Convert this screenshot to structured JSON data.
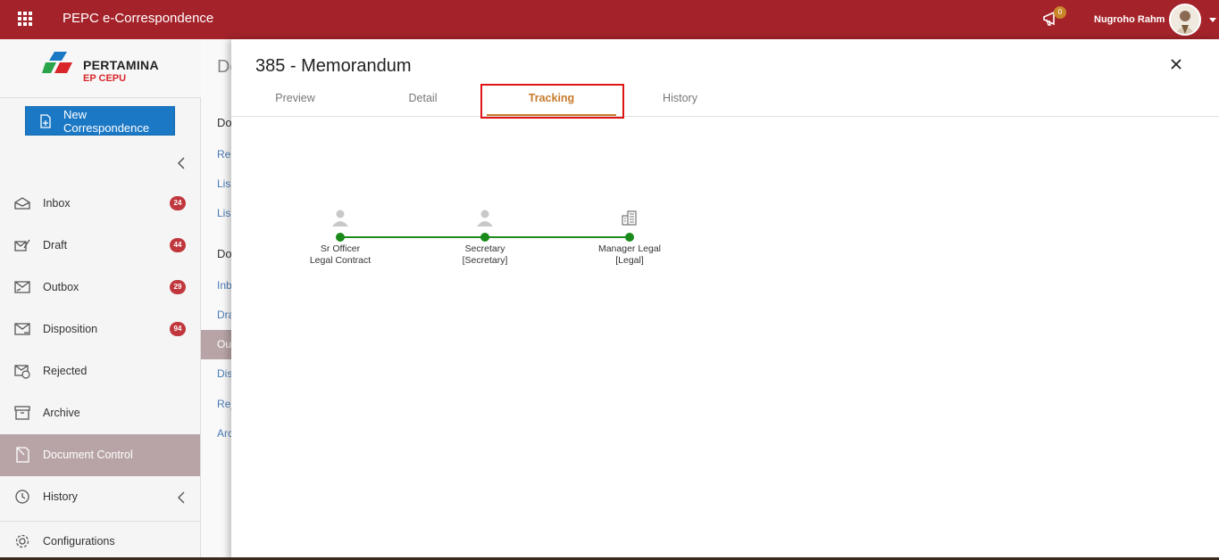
{
  "header": {
    "app_title": "PEPC e-Correspondence",
    "notification_count": "0",
    "user_name": "Nugroho Rahm"
  },
  "sidebar": {
    "logo_name": "PERTAMINA",
    "logo_sub": "EP CEPU",
    "new_button_label": "New Correspondence",
    "items": [
      {
        "label": "Inbox",
        "badge": "24",
        "icon": "inbox-icon"
      },
      {
        "label": "Draft",
        "badge": "44",
        "icon": "draft-icon"
      },
      {
        "label": "Outbox",
        "badge": "29",
        "icon": "outbox-icon"
      },
      {
        "label": "Disposition",
        "badge": "94",
        "icon": "disposition-icon"
      },
      {
        "label": "Rejected",
        "badge": "",
        "icon": "rejected-icon"
      },
      {
        "label": "Archive",
        "badge": "",
        "icon": "archive-icon"
      },
      {
        "label": "Document Control",
        "badge": "",
        "icon": "document-control-icon",
        "active": true
      },
      {
        "label": "History",
        "badge": "",
        "icon": "history-icon"
      },
      {
        "label": "Configurations",
        "badge": "",
        "icon": "gear-icon"
      }
    ]
  },
  "background_panel": {
    "title": "Do",
    "head1": "Do",
    "links1": [
      "Rec",
      "Lis",
      "Lis"
    ],
    "head2": "Do",
    "links2": [
      "Inb",
      "Dra",
      "Ou",
      "Dis",
      "Rej",
      "Arc"
    ]
  },
  "modal": {
    "title": "385 - Memorandum",
    "tabs": [
      "Preview",
      "Detail",
      "Tracking",
      "History"
    ],
    "active_tab": "Tracking",
    "tracking": [
      {
        "line1": "Sr Officer",
        "line2": "Legal Contract",
        "icon": "person-icon"
      },
      {
        "line1": "Secretary",
        "line2": "[Secretary]",
        "icon": "person-icon"
      },
      {
        "line1": "Manager Legal",
        "line2": "[Legal]",
        "icon": "building-icon"
      }
    ]
  },
  "colors": {
    "header_bg": "#a4232a",
    "accent_tab": "#c77b2c",
    "track_green": "#1d8c1d",
    "badge_red": "#c0383e",
    "button_blue": "#1b78c5"
  }
}
